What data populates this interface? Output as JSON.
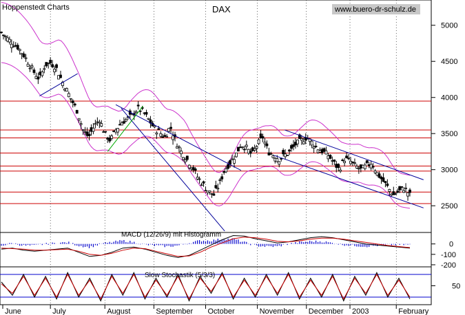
{
  "header": {
    "brand": "Hoppenstedt Charts",
    "title": "DAX",
    "website": "www.buero-dr-schulz.de"
  },
  "chart_data": [
    {
      "type": "candlestick",
      "title": "DAX",
      "y_ticks": [
        2500,
        3000,
        3500,
        4000,
        4500,
        5000
      ],
      "ylim": [
        2130,
        5350
      ],
      "x_range": [
        0,
        150
      ],
      "month_labels": [
        {
          "label": "June",
          "x": 0
        },
        {
          "label": "July",
          "x": 18
        },
        {
          "label": "August",
          "x": 38
        },
        {
          "label": "September",
          "x": 56
        },
        {
          "label": "October",
          "x": 75
        },
        {
          "label": "November",
          "x": 94
        },
        {
          "label": "December",
          "x": 112
        },
        {
          "label": "2003",
          "x": 128
        },
        {
          "label": "February",
          "x": 145
        }
      ],
      "close_path": [
        [
          0,
          4900
        ],
        [
          2,
          4820
        ],
        [
          4,
          4760
        ],
        [
          6,
          4700
        ],
        [
          8,
          4600
        ],
        [
          10,
          4480
        ],
        [
          12,
          4350
        ],
        [
          14,
          4250
        ],
        [
          16,
          4450
        ],
        [
          18,
          4480
        ],
        [
          20,
          4420
        ],
        [
          22,
          4250
        ],
        [
          24,
          4100
        ],
        [
          26,
          3950
        ],
        [
          28,
          3800
        ],
        [
          30,
          3550
        ],
        [
          32,
          3450
        ],
        [
          34,
          3600
        ],
        [
          36,
          3700
        ],
        [
          38,
          3500
        ],
        [
          40,
          3400
        ],
        [
          42,
          3550
        ],
        [
          44,
          3650
        ],
        [
          46,
          3700
        ],
        [
          48,
          3750
        ],
        [
          50,
          3850
        ],
        [
          52,
          3800
        ],
        [
          54,
          3700
        ],
        [
          56,
          3580
        ],
        [
          58,
          3520
        ],
        [
          60,
          3450
        ],
        [
          62,
          3600
        ],
        [
          64,
          3400
        ],
        [
          66,
          3250
        ],
        [
          68,
          3150
        ],
        [
          70,
          3050
        ],
        [
          72,
          2900
        ],
        [
          74,
          2800
        ],
        [
          76,
          2700
        ],
        [
          78,
          2650
        ],
        [
          80,
          2800
        ],
        [
          82,
          3000
        ],
        [
          84,
          3100
        ],
        [
          86,
          3200
        ],
        [
          88,
          3350
        ],
        [
          90,
          3300
        ],
        [
          92,
          3200
        ],
        [
          94,
          3350
        ],
        [
          96,
          3450
        ],
        [
          98,
          3250
        ],
        [
          100,
          3200
        ],
        [
          102,
          3150
        ],
        [
          104,
          3200
        ],
        [
          106,
          3250
        ],
        [
          108,
          3350
        ],
        [
          110,
          3400
        ],
        [
          112,
          3450
        ],
        [
          114,
          3380
        ],
        [
          116,
          3300
        ],
        [
          118,
          3250
        ],
        [
          120,
          3200
        ],
        [
          122,
          3100
        ],
        [
          124,
          3000
        ],
        [
          126,
          3150
        ],
        [
          128,
          3120
        ],
        [
          130,
          3050
        ],
        [
          132,
          3000
        ],
        [
          134,
          3050
        ],
        [
          136,
          3100
        ],
        [
          138,
          2950
        ],
        [
          140,
          2850
        ],
        [
          142,
          2750
        ],
        [
          144,
          2650
        ],
        [
          146,
          2700
        ],
        [
          148,
          2750
        ],
        [
          150,
          2650
        ]
      ],
      "horizontal_levels": [
        3950,
        3550,
        3440,
        3230,
        3050,
        2980,
        2690,
        2530
      ],
      "trend_lines": [
        {
          "color": "#000099",
          "from": [
            42,
            3900
          ],
          "to": [
            88,
            2990
          ]
        },
        {
          "color": "#000099",
          "from": [
            44,
            3850
          ],
          "to": [
            82,
            2150
          ]
        },
        {
          "color": "#000099",
          "from": [
            104,
            3550
          ],
          "to": [
            155,
            2860
          ]
        },
        {
          "color": "#000099",
          "from": [
            100,
            3200
          ],
          "to": [
            155,
            2470
          ]
        },
        {
          "color": "#00aa00",
          "from": [
            39,
            3250
          ],
          "to": [
            52,
            3880
          ]
        },
        {
          "color": "#000099",
          "from": [
            14,
            4020
          ],
          "to": [
            28,
            4330
          ]
        }
      ]
    },
    {
      "type": "line",
      "title": "MACD (12/26/9) mit Histogramm",
      "y_ticks": [
        0,
        -100,
        -200
      ],
      "ylim": [
        -220,
        110
      ],
      "series": [
        {
          "color": "#000000",
          "values": [
            -50,
            -40,
            -60,
            -70,
            -60,
            -50,
            -40,
            -80,
            -120,
            -110,
            -80,
            -40,
            -30,
            -50,
            -80,
            -110,
            -130,
            -110,
            -60,
            -10,
            40,
            80,
            75,
            50,
            30,
            10,
            20,
            40,
            60,
            70,
            60,
            40,
            20,
            0,
            -10,
            -20,
            -30,
            -40
          ]
        },
        {
          "color": "#cc0000",
          "values": [
            -40,
            -45,
            -50,
            -60,
            -60,
            -55,
            -50,
            -70,
            -100,
            -110,
            -90,
            -60,
            -40,
            -45,
            -70,
            -95,
            -120,
            -115,
            -80,
            -30,
            10,
            50,
            65,
            60,
            45,
            25,
            20,
            30,
            45,
            55,
            55,
            45,
            30,
            15,
            0,
            -15,
            -25,
            -35
          ]
        }
      ]
    },
    {
      "type": "line",
      "title": "Slow Stochastik (5/3/3)",
      "y_ticks": [
        50
      ],
      "ylim": [
        0,
        100
      ],
      "series": [
        {
          "color": "#000000",
          "values": [
            60,
            25,
            80,
            20,
            75,
            15,
            85,
            20,
            70,
            10,
            80,
            25,
            85,
            15,
            70,
            20,
            80,
            10,
            75,
            30,
            85,
            15,
            70,
            20,
            80,
            25,
            85,
            15,
            70,
            20,
            80,
            10,
            75,
            25,
            85,
            20,
            70,
            15
          ]
        },
        {
          "color": "#cc0000",
          "values": [
            55,
            30,
            75,
            25,
            70,
            20,
            80,
            25,
            65,
            15,
            75,
            30,
            80,
            20,
            65,
            25,
            75,
            15,
            70,
            35,
            80,
            20,
            65,
            25,
            75,
            30,
            80,
            20,
            65,
            25,
            75,
            15,
            70,
            30,
            80,
            25,
            65,
            20
          ]
        }
      ]
    }
  ]
}
